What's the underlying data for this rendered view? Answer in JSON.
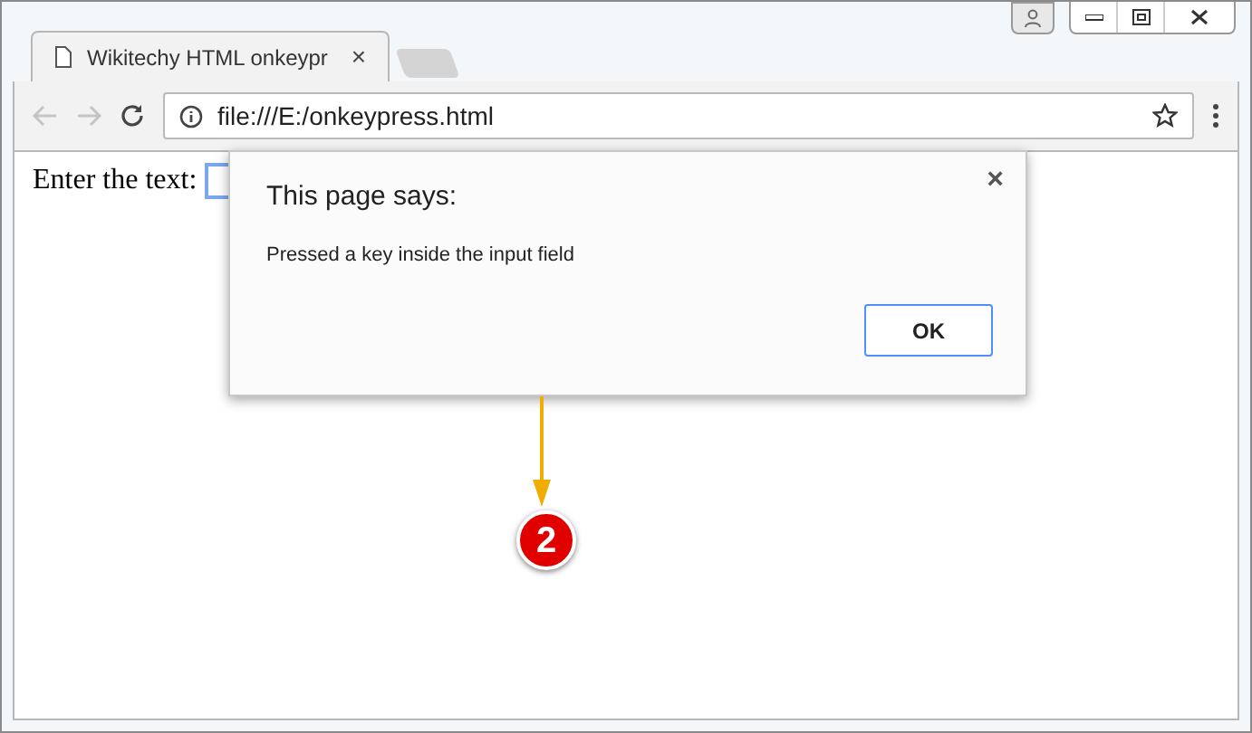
{
  "tab": {
    "title": "Wikitechy HTML onkeypr",
    "close": "×"
  },
  "address_bar": {
    "url": "file:///E:/onkeypress.html"
  },
  "page": {
    "label": "Enter the text:",
    "input_focused": true
  },
  "dialog": {
    "title": "This page says:",
    "message": "Pressed a key inside the input field",
    "close": "×",
    "button": "OK"
  },
  "annotation": {
    "step": "2"
  }
}
